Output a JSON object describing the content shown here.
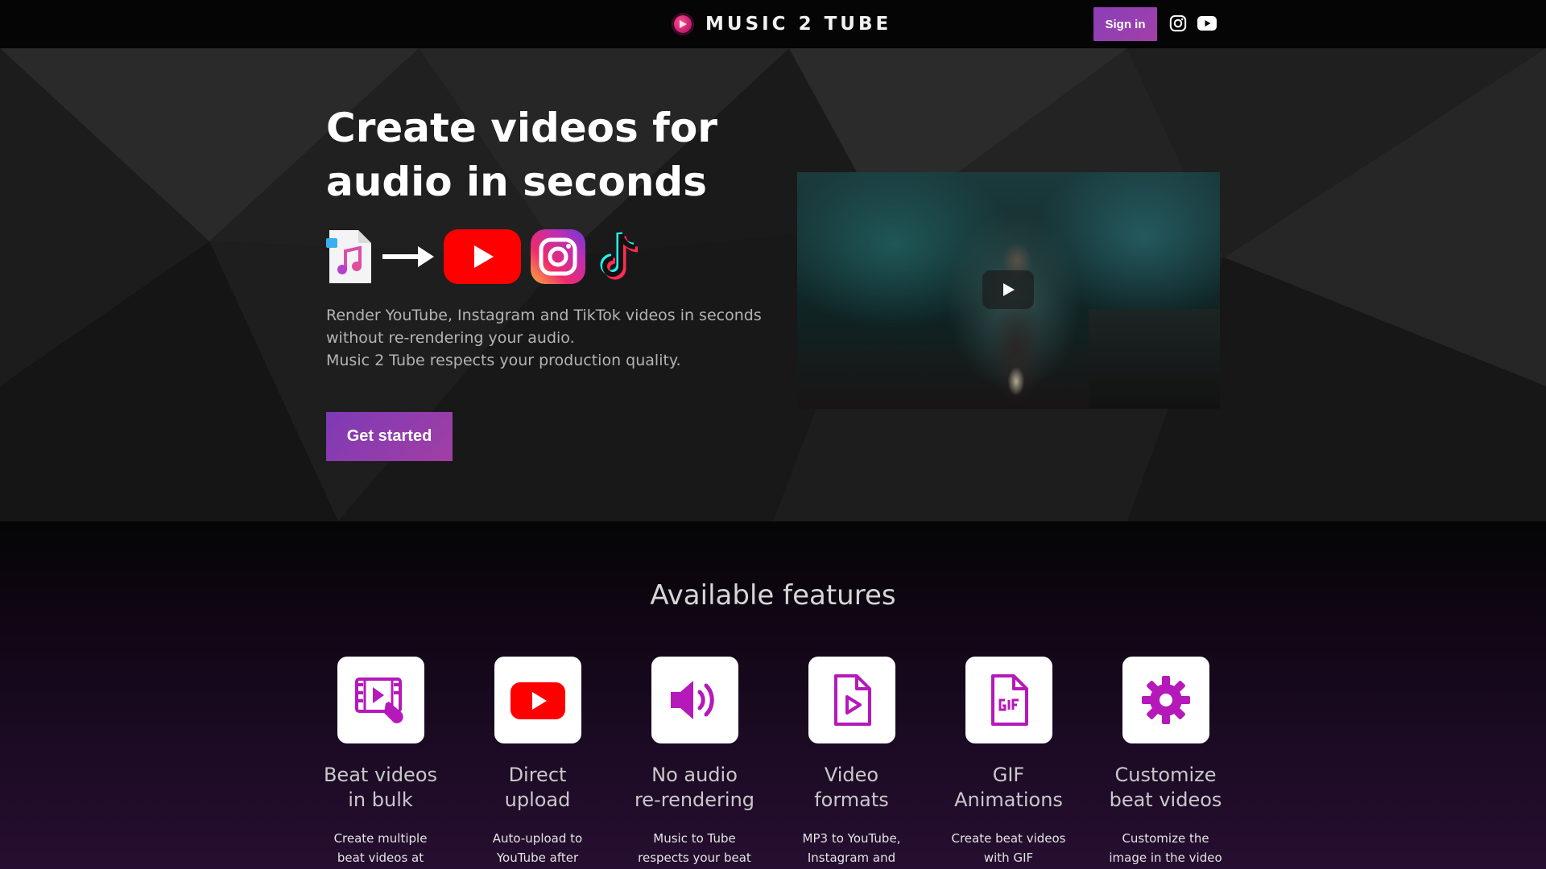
{
  "header": {
    "brand_name": "MUSIC 2 TUBE",
    "signin_label": "Sign in",
    "icons": [
      "brand-logo-icon",
      "instagram-icon",
      "youtube-icon"
    ]
  },
  "hero": {
    "title": "Create videos for audio in seconds",
    "icons": [
      "music-file-icon",
      "arrow-right-icon",
      "youtube-icon",
      "instagram-icon",
      "tiktok-icon"
    ],
    "description": [
      "Render YouTube, Instagram and TikTok videos in seconds",
      "without re-rendering your audio.",
      "Music 2 Tube respects your production quality."
    ],
    "cta_label": "Get started",
    "video_icon": "play-icon"
  },
  "features": {
    "title": "Available features",
    "items": [
      {
        "icon": "video-cursor-icon",
        "title": [
          "Beat videos",
          "in bulk"
        ],
        "desc": [
          "Create multiple",
          "beat videos at"
        ]
      },
      {
        "icon": "youtube-icon",
        "title": [
          "Direct",
          "upload"
        ],
        "desc": [
          "Auto-upload to",
          "YouTube after"
        ]
      },
      {
        "icon": "speaker-icon",
        "title": [
          "No audio",
          "re-rendering"
        ],
        "desc": [
          "Music to Tube",
          "respects your beat"
        ]
      },
      {
        "icon": "video-file-icon",
        "title": [
          "Video",
          "formats"
        ],
        "desc": [
          "MP3 to YouTube,",
          "Instagram and"
        ]
      },
      {
        "icon": "gif-file-icon",
        "title": [
          "GIF",
          "Animations"
        ],
        "desc": [
          "Create beat videos",
          "with GIF"
        ]
      },
      {
        "icon": "gear-icon",
        "title": [
          "Customize",
          "beat videos"
        ],
        "desc": [
          "Customize the",
          "image in the video"
        ]
      }
    ]
  },
  "colors": {
    "accent": "#9a3eab",
    "feature_icon": "#b519b9",
    "youtube_red": "#ff0000"
  }
}
